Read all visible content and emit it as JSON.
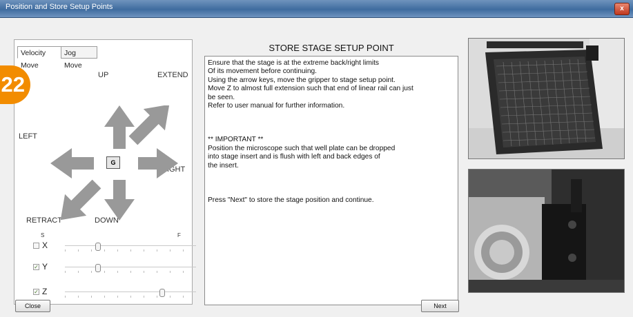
{
  "window": {
    "title": "Position and Store Setup Points",
    "close_glyph": "x"
  },
  "step_badge": "22",
  "tabs": [
    "Velocity Move",
    "Jog Move"
  ],
  "direction_labels": {
    "up": "UP",
    "extend": "EXTEND",
    "left": "LEFT",
    "right": "RIGHT",
    "retract": "RETRACT",
    "down": "DOWN"
  },
  "center_button": "G",
  "slider_ends": {
    "slow": "S",
    "fast": "F"
  },
  "axes": [
    {
      "label": "X",
      "checked": false,
      "value": 0.25
    },
    {
      "label": "Y",
      "checked": true,
      "value": 0.25
    },
    {
      "label": "Z",
      "checked": true,
      "value": 0.74
    }
  ],
  "panel": {
    "title": "STORE STAGE SETUP POINT",
    "lines1": [
      "Ensure that the stage is at the extreme back/right limits",
      "Of its movement before continuing.",
      "Using the arrow keys, move the gripper to stage setup point.",
      "Move Z to almost full extension such that end of linear rail can just",
      "be seen.",
      "Refer to user manual for further information."
    ],
    "lines2": [
      "** IMPORTANT **",
      "Position the microscope such that well plate can be dropped",
      "into stage insert and is flush with left and back edges of",
      "the insert."
    ],
    "lines3": [
      "Press \"Next\" to store the stage position and continue."
    ]
  },
  "buttons": {
    "close": "Close",
    "next": "Next"
  },
  "colors": {
    "badge": "#f28c00",
    "arrow": "#999999",
    "titlebar": "#3f6c9f"
  }
}
